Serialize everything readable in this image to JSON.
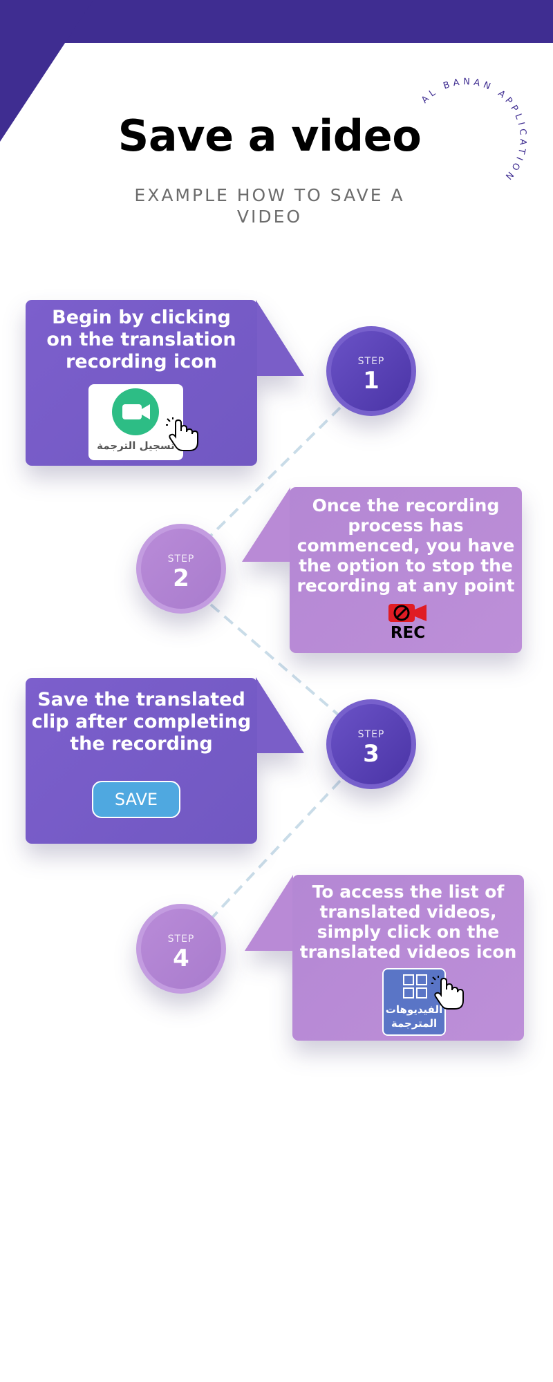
{
  "header": {
    "title": "Save a video",
    "subtitle": "EXAMPLE HOW TO SAVE A VIDEO",
    "arc_text": "AL BANAN APPLICATION"
  },
  "colors": {
    "primary": "#3f2d91",
    "card_dark": "#7a5ec8",
    "card_light": "#b98ad6",
    "connector": "#c9dce8",
    "save_button": "#4fa8e0"
  },
  "steps": [
    {
      "label": "STEP",
      "number": "1",
      "lines": [
        "Begin by clicking",
        "on the translation",
        "recording icon"
      ],
      "icon_name": "video-camera-icon",
      "icon_caption": "تسجيل الترجمة"
    },
    {
      "label": "STEP",
      "number": "2",
      "lines": [
        "Once the recording",
        "process has",
        "commenced, you have",
        "the option to stop the",
        "recording at any point"
      ],
      "icon_name": "stop-recording-icon",
      "icon_caption": "REC"
    },
    {
      "label": "STEP",
      "number": "3",
      "lines": [
        "Save the translated",
        "clip after completing",
        "the recording"
      ],
      "icon_name": "save-button",
      "button_label": "SAVE"
    },
    {
      "label": "STEP",
      "number": "4",
      "lines": [
        "To access the list of",
        "translated videos,",
        "simply click on the",
        "translated videos icon"
      ],
      "icon_name": "grid-icon",
      "icon_caption_1": "الفيديوهات",
      "icon_caption_2": "المترجمة"
    }
  ]
}
